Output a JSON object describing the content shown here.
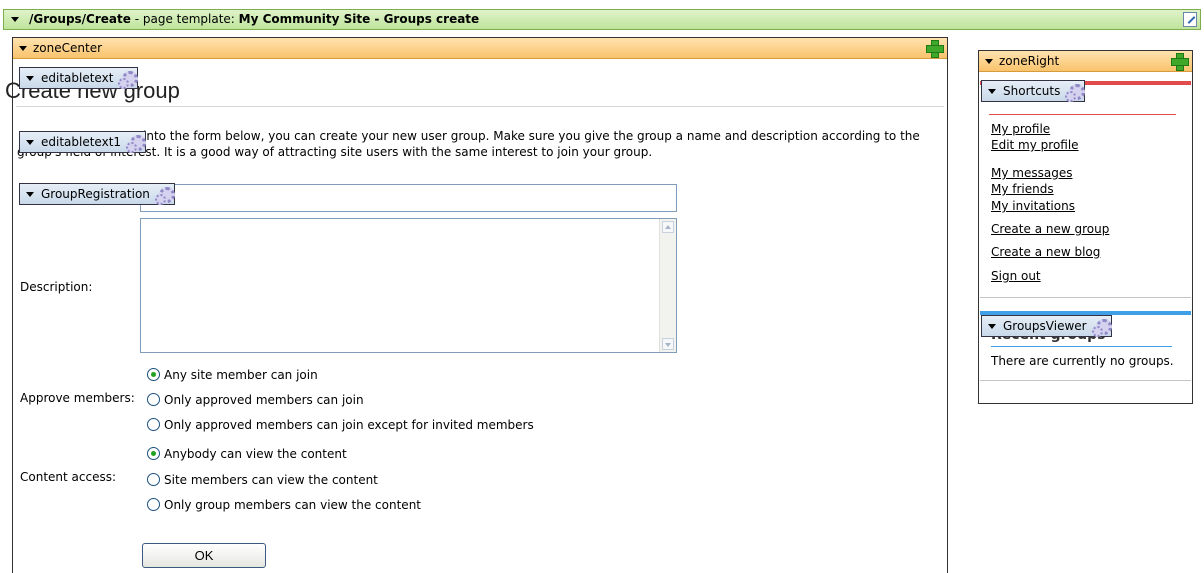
{
  "page_bar": {
    "path": "/Groups/Create",
    "middle": " - page template: ",
    "template": "My Community Site - Groups create"
  },
  "zone_center": {
    "title": "zoneCenter",
    "webparts": {
      "editabletext": "editabletext",
      "editabletext1": "editabletext1",
      "group_registration": "GroupRegistration"
    },
    "heading": "Create new group",
    "intro_line1": "into the form below, you can create your new user group. Make sure you give the group a  name and description according to the",
    "intro_line2": "group's field of interest. It is a good way of attracting site users with the same interest to join your group.",
    "form": {
      "description_label": "Description:",
      "approve_label": "Approve members:",
      "approve_options": [
        {
          "label": "Any site member can join",
          "checked": true
        },
        {
          "label": "Only approved members can join",
          "checked": false
        },
        {
          "label": "Only approved members can join except for invited members",
          "checked": false
        }
      ],
      "content_label": "Content access:",
      "content_options": [
        {
          "label": "Anybody can view the content",
          "checked": true
        },
        {
          "label": "Site members can view the content",
          "checked": false
        },
        {
          "label": "Only group members can view the content",
          "checked": false
        }
      ],
      "ok_label": "OK"
    }
  },
  "zone_right": {
    "title": "zoneRight",
    "webparts": {
      "shortcuts": "Shortcuts",
      "groups_viewer": "GroupsViewer"
    },
    "shortcut_links": [
      "My profile",
      "Edit my profile",
      "My messages",
      "My friends",
      "My invitations",
      "Create a new group",
      "Create a new blog",
      "Sign out"
    ],
    "groups_title": "Recent groups",
    "groups_empty": "There are currently no groups."
  }
}
